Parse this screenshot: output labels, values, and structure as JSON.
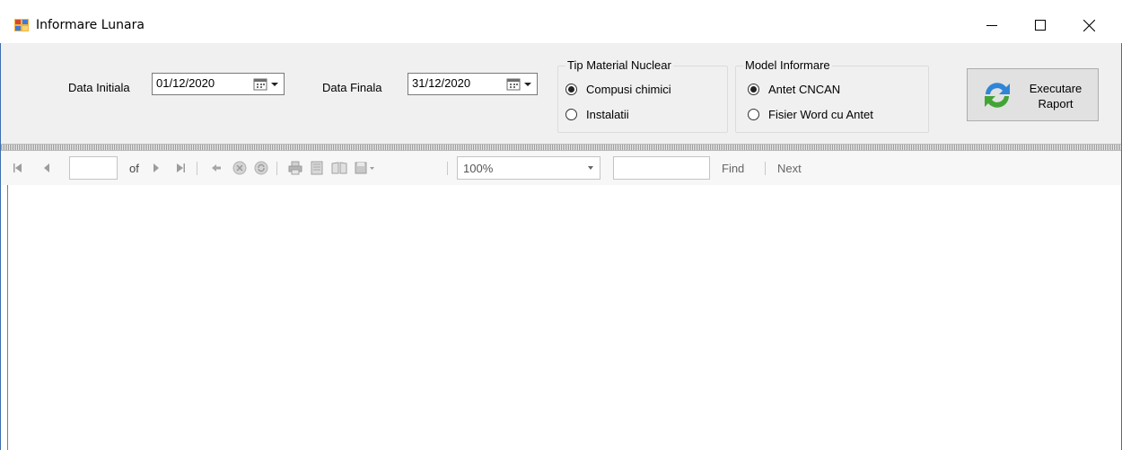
{
  "window": {
    "title": "Informare Lunara"
  },
  "filters": {
    "date_start_label": "Data Initiala",
    "date_start_value": "01/12/2020",
    "date_end_label": "Data Finala",
    "date_end_value": "31/12/2020"
  },
  "material_group": {
    "title": "Tip Material Nuclear",
    "options": [
      {
        "label": "Compusi chimici",
        "selected": true
      },
      {
        "label": "Instalatii",
        "selected": false
      }
    ]
  },
  "model_group": {
    "title": "Model Informare",
    "options": [
      {
        "label": "Antet CNCAN",
        "selected": true
      },
      {
        "label": "Fisier Word cu Antet",
        "selected": false
      }
    ]
  },
  "execute_button": {
    "line1": "Executare",
    "line2": "Raport"
  },
  "report_toolbar": {
    "page_value": "",
    "of_label": "of",
    "zoom_value": "100%",
    "find_value": "",
    "find_label": "Find",
    "next_label": "Next"
  }
}
